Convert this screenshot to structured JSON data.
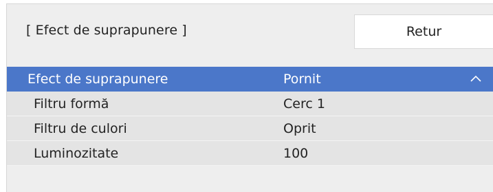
{
  "header": {
    "title": "[ Efect de suprapunere ]",
    "back_label": "Retur"
  },
  "menu": {
    "rows": [
      {
        "label": "Efect de suprapunere",
        "value": "Pornit",
        "selected": true,
        "icon": "chevron-up-icon"
      },
      {
        "label": "Filtru formă",
        "value": "Cerc 1",
        "selected": false
      },
      {
        "label": "Filtru de culori",
        "value": "Oprit",
        "selected": false
      },
      {
        "label": "Luminozitate",
        "value": "100",
        "selected": false
      }
    ]
  },
  "colors": {
    "selected_row": "#4b77c9",
    "row_background": "#e4e4e4",
    "panel_background": "#eeeeee"
  }
}
